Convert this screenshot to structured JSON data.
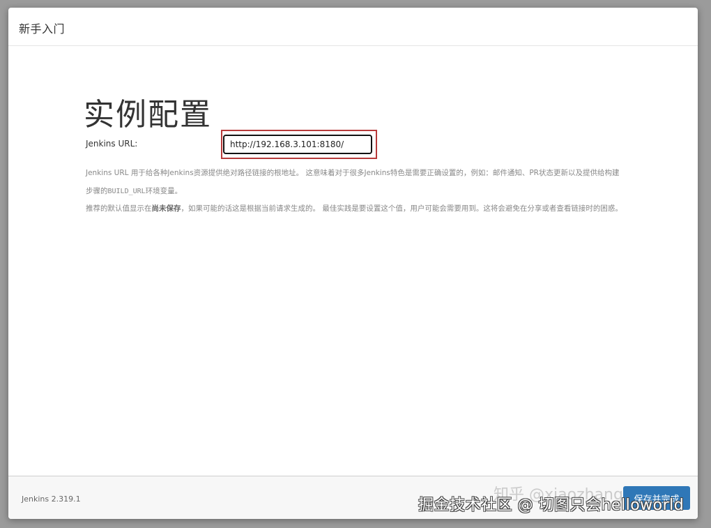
{
  "dialog": {
    "title": "新手入门"
  },
  "main": {
    "page_title": "实例配置",
    "url_field": {
      "label": "Jenkins URL:",
      "value": "http://192.168.3.101:8180/"
    },
    "help": {
      "paragraph1_part1": "Jenkins URL 用于给各种Jenkins资源提供绝对路径链接的根地址。 这意味着对于很多Jenkins特色是需要正确设置的，例如：邮件通知、PR状态更新以及提供给构建步骤的",
      "paragraph1_code": "BUILD_URL",
      "paragraph1_part2": "环境变量。",
      "paragraph2_part1": "推荐的默认值显示在",
      "paragraph2_strong": "尚未保存",
      "paragraph2_part2": "，如果可能的话这是根据当前请求生成的。 最佳实践是要设置这个值，用户可能会需要用到。这将会避免在分享或者查看链接时的困惑。"
    }
  },
  "footer": {
    "version": "Jenkins 2.319.1",
    "save_label": "保存并完成"
  },
  "watermark": {
    "text": "掘金技术社区 @ 切图只会helloworld",
    "faint_text": "知乎 @xiaozhang"
  },
  "colors": {
    "primary_button": "#2f77b7",
    "highlight_border": "#b73a3a"
  }
}
